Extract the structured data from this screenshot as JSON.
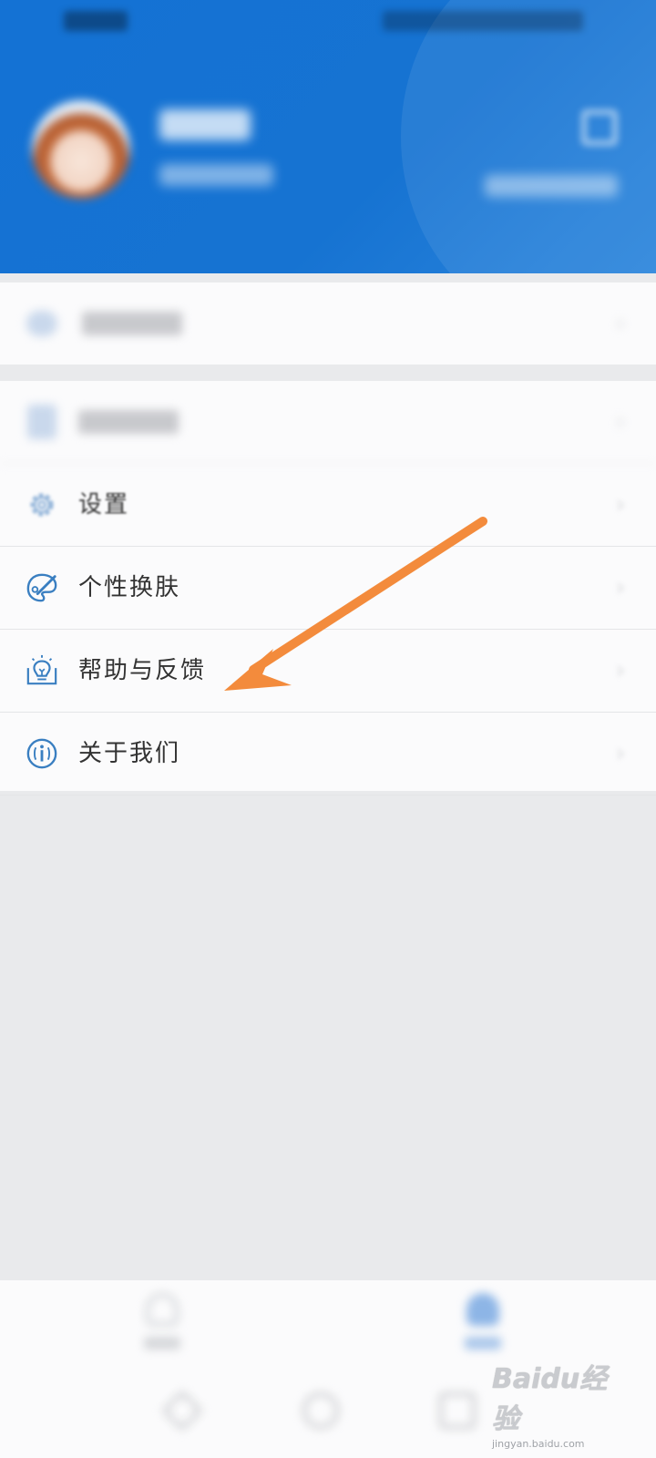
{
  "menu": {
    "items": [
      {
        "label": "设置"
      },
      {
        "label": "个性换肤"
      },
      {
        "label": "帮助与反馈"
      },
      {
        "label": "关于我们"
      }
    ]
  },
  "colors": {
    "header_blue": "#1472d4",
    "icon_blue": "#3a7fc1",
    "arrow_orange": "#f38b3c",
    "background": "#e9eaec"
  },
  "icons": {
    "settings": "gear-icon",
    "skin": "palette-brush-icon",
    "help": "lightbulb-icon",
    "about": "info-icon"
  },
  "watermark": {
    "brand": "Baidu经验",
    "url": "jingyan.baidu.com"
  }
}
